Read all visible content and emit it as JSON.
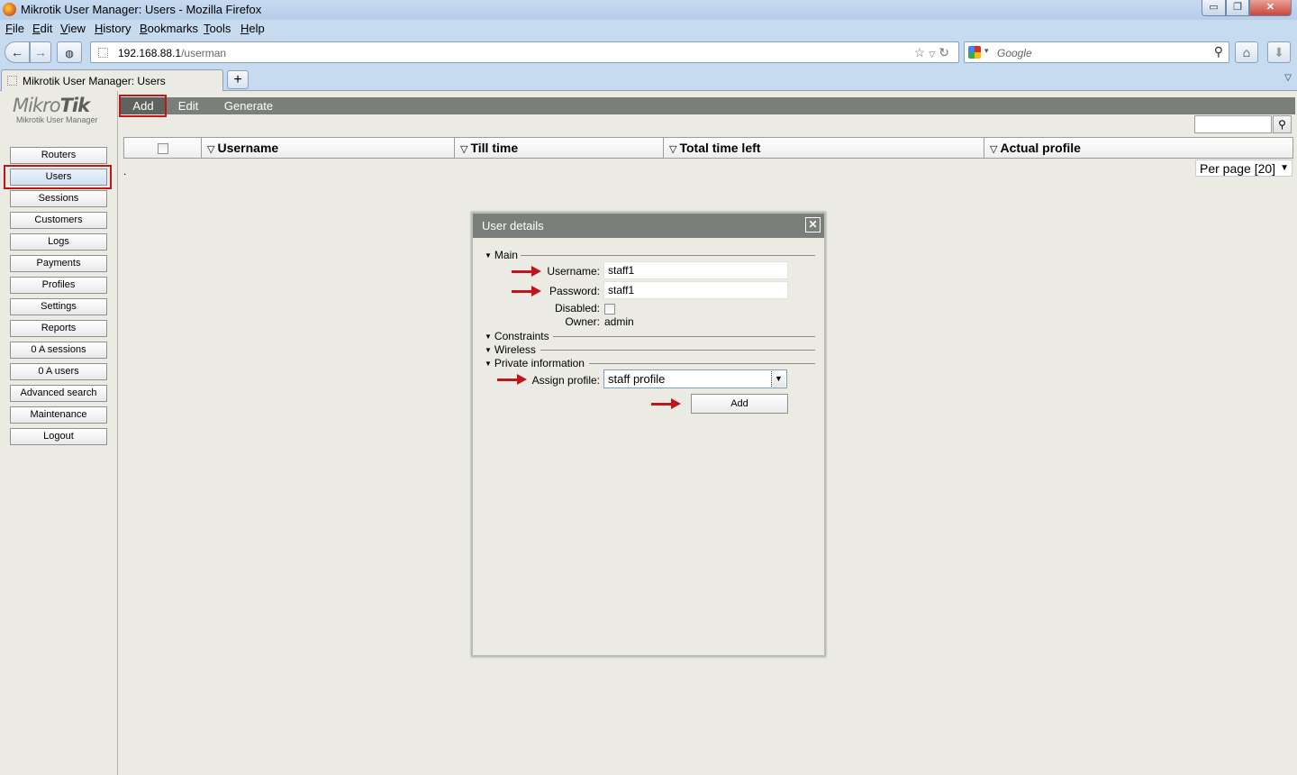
{
  "window": {
    "title": "Mikrotik User Manager: Users - Mozilla Firefox",
    "minimize": "▭",
    "maximize": "❐",
    "close": "✕"
  },
  "menu": [
    "File",
    "Edit",
    "View",
    "History",
    "Bookmarks",
    "Tools",
    "Help"
  ],
  "navigation": {
    "url_host": "192.168.88.1",
    "url_path": "/userman",
    "search_placeholder": "Google"
  },
  "tabs": [
    {
      "title": "Mikrotik User Manager: Users",
      "active": true
    }
  ],
  "logo": {
    "brand_light": "Mikro",
    "brand_bold": "Tik",
    "subtitle": "Mikrotik User Manager"
  },
  "sidebar": {
    "items": [
      {
        "label": "Routers"
      },
      {
        "label": "Users",
        "active": true
      },
      {
        "label": "Sessions"
      },
      {
        "label": "Customers"
      },
      {
        "label": "Logs"
      },
      {
        "label": "Payments"
      },
      {
        "label": "Profiles"
      },
      {
        "label": "Settings"
      },
      {
        "label": "Reports"
      },
      {
        "label": "0 A sessions"
      },
      {
        "label": "0 A users"
      },
      {
        "label": "Advanced search"
      },
      {
        "label": "Maintenance"
      },
      {
        "label": "Logout"
      }
    ]
  },
  "toolbar": {
    "add": "Add",
    "edit": "Edit",
    "generate": "Generate"
  },
  "grid": {
    "columns": [
      "Username",
      "Till time",
      "Total time left",
      "Actual profile"
    ],
    "empty_marker": ".",
    "per_page": "Per page [20]"
  },
  "dialog": {
    "title": "User details",
    "sections": {
      "main": "Main",
      "constraints": "Constraints",
      "wireless": "Wireless",
      "private_information": "Private information"
    },
    "fields": {
      "username_label": "Username:",
      "username_value": "staff1",
      "password_label": "Password:",
      "password_value": "staff1",
      "disabled_label": "Disabled:",
      "disabled_checked": false,
      "owner_label": "Owner:",
      "owner_value": "admin",
      "assign_profile_label": "Assign profile:",
      "assign_profile_value": "staff profile"
    },
    "submit": "Add"
  },
  "colors": {
    "highlight": "#c0151b",
    "toolbar": "#7b7f7a",
    "page_bg": "#ebebe3"
  }
}
